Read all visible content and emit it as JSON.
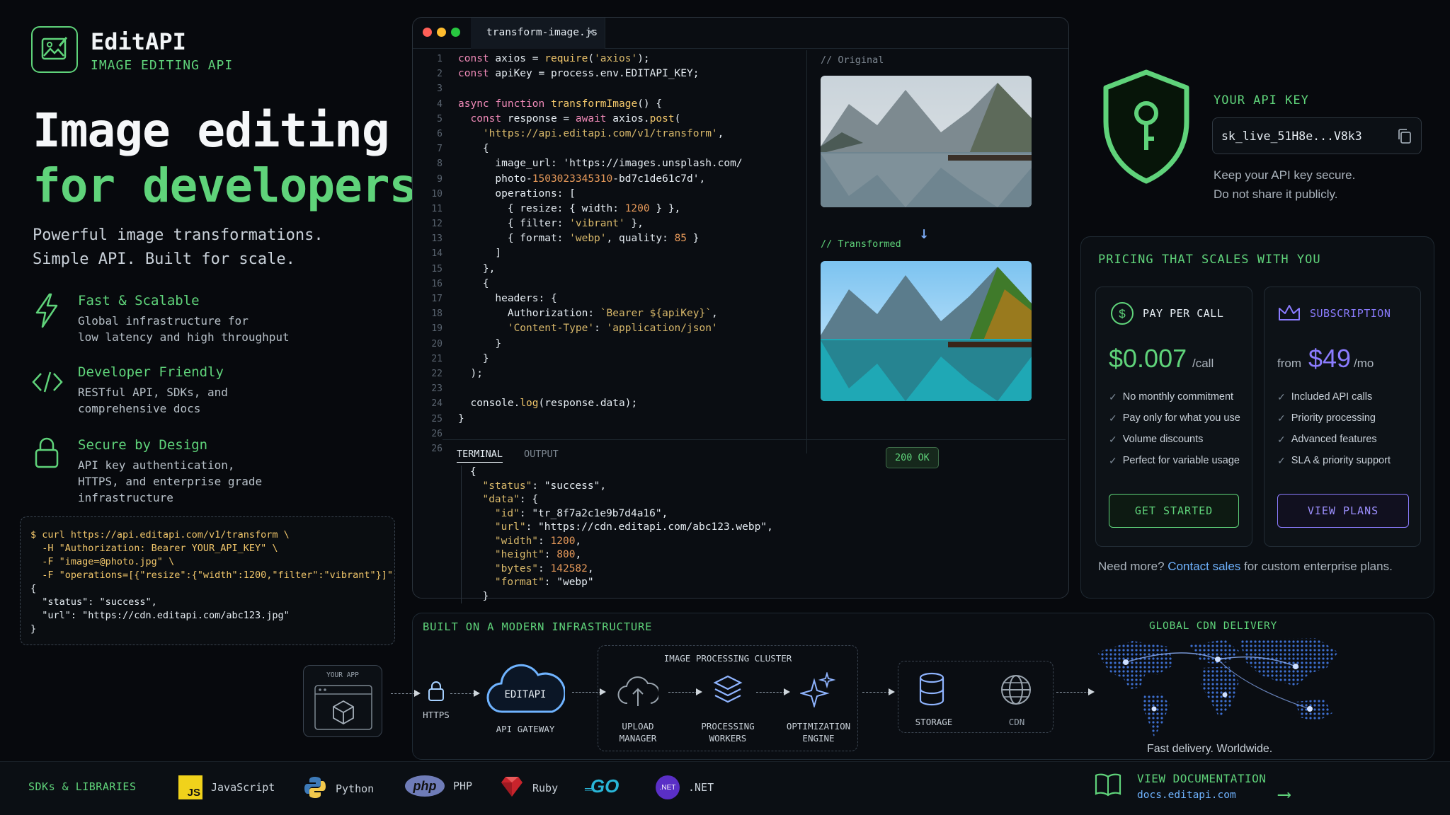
{
  "brand": {
    "name": "EditAPI",
    "tagline": "IMAGE EDITING API"
  },
  "hero": {
    "line1": "Image editing",
    "line2": "for developers",
    "sub1": "Powerful image transformations.",
    "sub2": "Simple API. Built for scale."
  },
  "features": [
    {
      "icon": "lightning-icon",
      "title": "Fast & Scalable",
      "desc": "Global infrastructure for\nlow latency and high throughput"
    },
    {
      "icon": "code-icon",
      "title": "Developer Friendly",
      "desc": "RESTful API, SDKs, and\ncomprehensive docs"
    },
    {
      "icon": "lock-icon",
      "title": "Secure by Design",
      "desc": "API key authentication,\nHTTPS, and enterprise grade\ninfrastructure"
    }
  ],
  "curl_lines": [
    "$ curl https://api.editapi.com/v1/transform \\",
    "  -H \"Authorization: Bearer YOUR_API_KEY\" \\",
    "  -F \"image=@photo.jpg\" \\",
    "  -F \"operations=[{\"resize\":{\"width\":1200,\"filter\":\"vibrant\"}]\"",
    "{",
    "  \"status\": \"success\",",
    "  \"url\": \"https://cdn.editapi.com/abc123.jpg\"",
    "}"
  ],
  "editor": {
    "tab_name": "transform-image.js",
    "line_numbers": [
      "1",
      "2",
      "3",
      "4",
      "5",
      "6",
      "7",
      "8",
      "9",
      "10",
      "11",
      "12",
      "13",
      "14",
      "15",
      "16",
      "17",
      "18",
      "19",
      "20",
      "21",
      "22",
      "23",
      "24",
      "25",
      "26",
      "26"
    ],
    "code_lines": [
      "const axios = require('axios');",
      "const apiKey = process.env.EDITAPI_KEY;",
      "",
      "async function transformImage() {",
      "  const response = await axios.post(",
      "    'https://api.editapi.com/v1/transform',",
      "    {",
      "      image_url: 'https://images.unsplash.com/",
      "      photo-1503023345310-bd7c1de61c7d',",
      "      operations: [",
      "        { resize: { width: 1200 } },",
      "        { filter: 'vibrant' },",
      "        { format: 'webp', quality: 85 }",
      "      ]",
      "    },",
      "    {",
      "      headers: {",
      "        Authorization: `Bearer ${apiKey}`,",
      "        'Content-Type': 'application/json'",
      "      }",
      "    }",
      "  );",
      "",
      "  console.log(response.data);",
      "}"
    ],
    "preview_original": "// Original",
    "preview_transformed": "// Transformed",
    "terminal_tab": "TERMINAL",
    "output_tab": "OUTPUT",
    "status_badge": "200 OK",
    "terminal_lines": [
      "{",
      "  \"status\": \"success\",",
      "  \"data\": {",
      "    \"id\": \"tr_8f7a2c1e9b7d4a16\",",
      "    \"url\": \"https://cdn.editapi.com/abc123.webp\",",
      "    \"width\": 1200,",
      "    \"height\": 800,",
      "    \"bytes\": 142582,",
      "    \"format\": \"webp\"",
      "  }"
    ]
  },
  "api_key": {
    "label": "YOUR API KEY",
    "value": "sk_live_51H8e...V8k3",
    "note1": "Keep your API key secure.",
    "note2": "Do not share it publicly."
  },
  "pricing": {
    "title": "PRICING THAT SCALES WITH YOU",
    "ppc": {
      "name": "PAY PER CALL",
      "price": "$0.007",
      "unit": "/call",
      "items": [
        "No monthly commitment",
        "Pay only for what you use",
        "Volume discounts",
        "Perfect for variable usage"
      ],
      "button": "GET STARTED"
    },
    "sub": {
      "name": "SUBSCRIPTION",
      "from": "from",
      "price": "$49",
      "unit": "/mo",
      "items": [
        "Included API calls",
        "Priority processing",
        "Advanced features",
        "SLA & priority support"
      ],
      "button": "VIEW PLANS"
    },
    "footer_pre": "Need more?",
    "footer_link": "Contact sales",
    "footer_post": "for custom enterprise plans."
  },
  "infra": {
    "title": "BUILT ON A MODERN INFRASTRUCTURE",
    "your_app": "YOUR APP",
    "https": "HTTPS",
    "gateway_name": "EDITAPI",
    "gateway_label": "API GATEWAY",
    "cluster_title": "IMAGE PROCESSING CLUSTER",
    "upload": "UPLOAD\nMANAGER",
    "processing": "PROCESSING\nWORKERS",
    "optimization": "OPTIMIZATION\nENGINE",
    "storage": "STORAGE",
    "cdn": "CDN",
    "cdn_title": "GLOBAL CDN DELIVERY",
    "cdn_note": "Fast delivery. Worldwide."
  },
  "footer": {
    "sdks_label": "SDKs & LIBRARIES",
    "sdks": [
      {
        "name": "JavaScript",
        "icon": "javascript-icon"
      },
      {
        "name": "Python",
        "icon": "python-icon"
      },
      {
        "name": "PHP",
        "icon": "php-icon"
      },
      {
        "name": "Ruby",
        "icon": "ruby-icon"
      },
      {
        "name": "",
        "icon": "go-icon"
      },
      {
        "name": ".NET",
        "icon": "dotnet-icon"
      }
    ],
    "php_logo": "php",
    "go_logo": "GO",
    "js_logo": "JS",
    "net_logo": ".NET",
    "docs_label": "VIEW DOCUMENTATION",
    "docs_url": "docs.editapi.com"
  },
  "colors": {
    "accent_green": "#5fd37a",
    "accent_purple": "#8b7cff",
    "background": "#07090d"
  }
}
